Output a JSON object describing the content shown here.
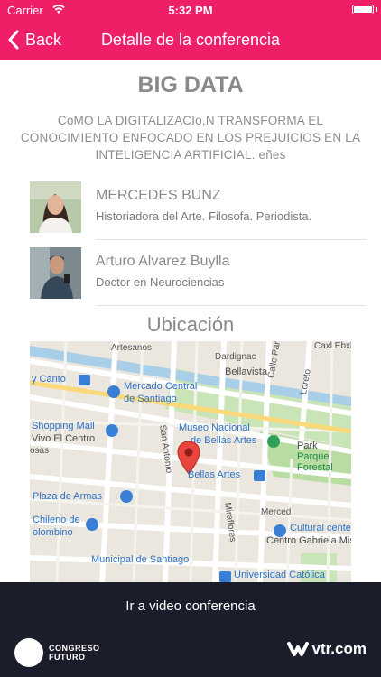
{
  "status_bar": {
    "carrier": "Carrier",
    "time": "5:32 PM"
  },
  "nav": {
    "back_label": "Back",
    "title": "Detalle de la conferencia"
  },
  "conference": {
    "title": "BIG DATA",
    "description": "CoMO LA DIGITALIZACIo,N TRANSFORMA EL CONOCIMIENTO ENFOCADO EN LOS PREJUICIOS EN LA INTELIGENCIA ARTIFICIAL. eñes"
  },
  "speakers": [
    {
      "name": "MERCEDES BUNZ",
      "role": "Historiadora del Arte. Filosofa. Periodista."
    },
    {
      "name": "Arturo Alvarez Buylla",
      "role": "Doctor en Neurociencias"
    }
  ],
  "location": {
    "title": "Ubicación",
    "map_labels": {
      "artesanos": "Artesanos",
      "dardignac": "Dardignac",
      "bellavista": "Bellavista",
      "calle_parte": "Calle Parte",
      "loreto": "Loreto",
      "caxlbuxlr": "Caxl Ebxlr",
      "y_canto": "y Canto",
      "mercado_central_1": "Mercado Central",
      "mercado_central_2": "de Santiago",
      "san_antonio": "San Antonio",
      "shopping_mall_1": "Shopping Mall",
      "shopping_mall_2": "Vivo El Centro",
      "osas": "osas",
      "museo_1": "Museo Nacional",
      "museo_2": "de Bellas Artes",
      "park_1": "Park",
      "park_2": "Parque",
      "park_3": "Forestal",
      "bellas_artes": "Bellas Artes",
      "plaza_armas": "Plaza de Armas",
      "merced": "Merced",
      "chileno_1": "Chileno de",
      "chileno_2": "olombino",
      "miraflores": "Miraflores",
      "cultural_1": "Cultural center",
      "cultural_2": "Centro Gabriela Mistral",
      "municipal": "Municipal de Santiago",
      "universidad": "Universidad Católica"
    }
  },
  "bottom": {
    "video_button": "Ir a video conferencia",
    "logo_left_line1": "CONGRESO",
    "logo_left_line2": "FUTURO",
    "logo_right": "vtr.com"
  },
  "colors": {
    "primary": "#ef1f67",
    "footer": "#1c1d2b"
  }
}
